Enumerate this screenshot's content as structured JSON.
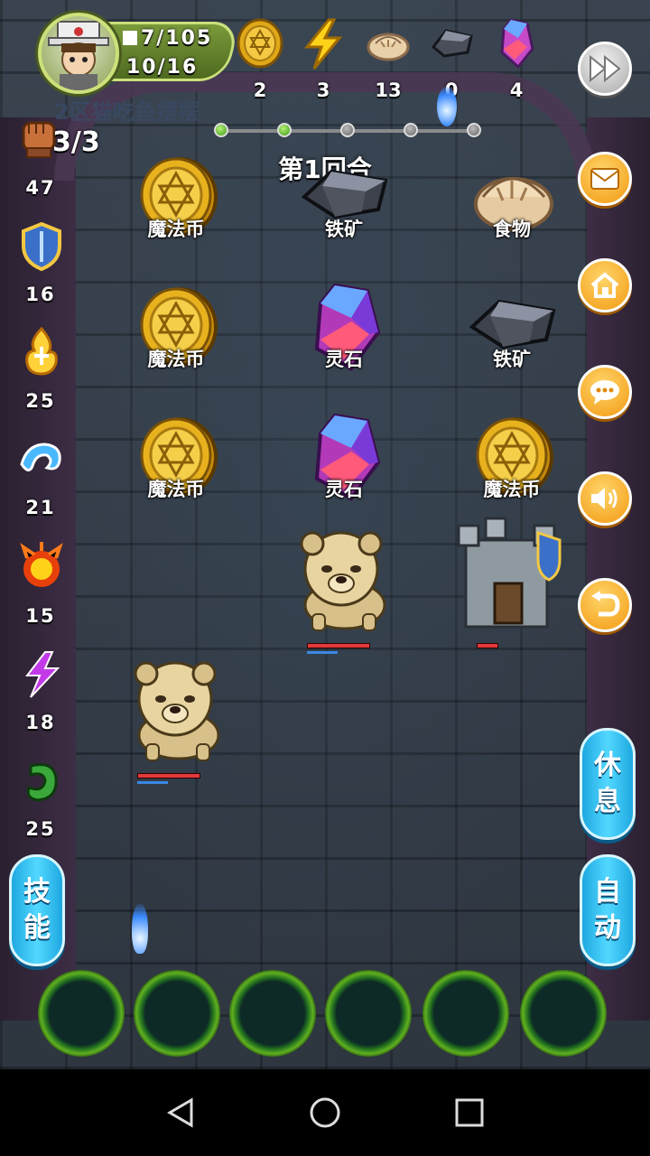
{
  "player": {
    "cards_line": "7/105",
    "hp_line": "10/16",
    "avatar_icon": "wizard-avatar-icon"
  },
  "resources": [
    {
      "name": "magic-coin",
      "icon": "coin-icon",
      "count": "2"
    },
    {
      "name": "energy",
      "icon": "lightning-icon",
      "count": "3"
    },
    {
      "name": "food",
      "icon": "dumpling-icon",
      "count": "13"
    },
    {
      "name": "iron-ore",
      "icon": "iron-ore-icon",
      "count": "0"
    },
    {
      "name": "spirit-stone",
      "icon": "crystal-icon",
      "count": "4"
    }
  ],
  "background_text": "2区猫吃鱼摆摆",
  "energy": "3/3",
  "round_title": "第1回合",
  "stages": [
    {
      "state": "done"
    },
    {
      "state": "done"
    },
    {
      "state": "todo"
    },
    {
      "state": "todo"
    },
    {
      "state": "todo"
    }
  ],
  "stats": [
    {
      "icon": "fist-icon",
      "value": "47"
    },
    {
      "icon": "shield-icon",
      "value": "16"
    },
    {
      "icon": "holy-flame-icon",
      "value": "25"
    },
    {
      "icon": "wave-icon",
      "value": "21"
    },
    {
      "icon": "fire-icon",
      "value": "15"
    },
    {
      "icon": "lightning-purple-icon",
      "value": "18"
    },
    {
      "icon": "poison-icon",
      "value": "25"
    }
  ],
  "board": {
    "row1": [
      "魔法币",
      "铁矿",
      "食物"
    ],
    "row2": [
      "魔法币",
      "灵石",
      "铁矿"
    ],
    "row3": [
      "魔法币",
      "灵石",
      "魔法币"
    ]
  },
  "units": {
    "dog1": {
      "hp": 1.0,
      "mp": 0.5
    },
    "tower": {
      "hp": 1.0
    },
    "dog2": {
      "hp": 1.0,
      "mp": 0.5
    }
  },
  "buttons": {
    "rest": "休息",
    "auto": "自动",
    "skill": "技能"
  },
  "colors": {
    "orange_button": "#f29a12",
    "blue_button": "#1ea8e0",
    "hp": "#e23a3a",
    "mp": "#3a88e2"
  }
}
